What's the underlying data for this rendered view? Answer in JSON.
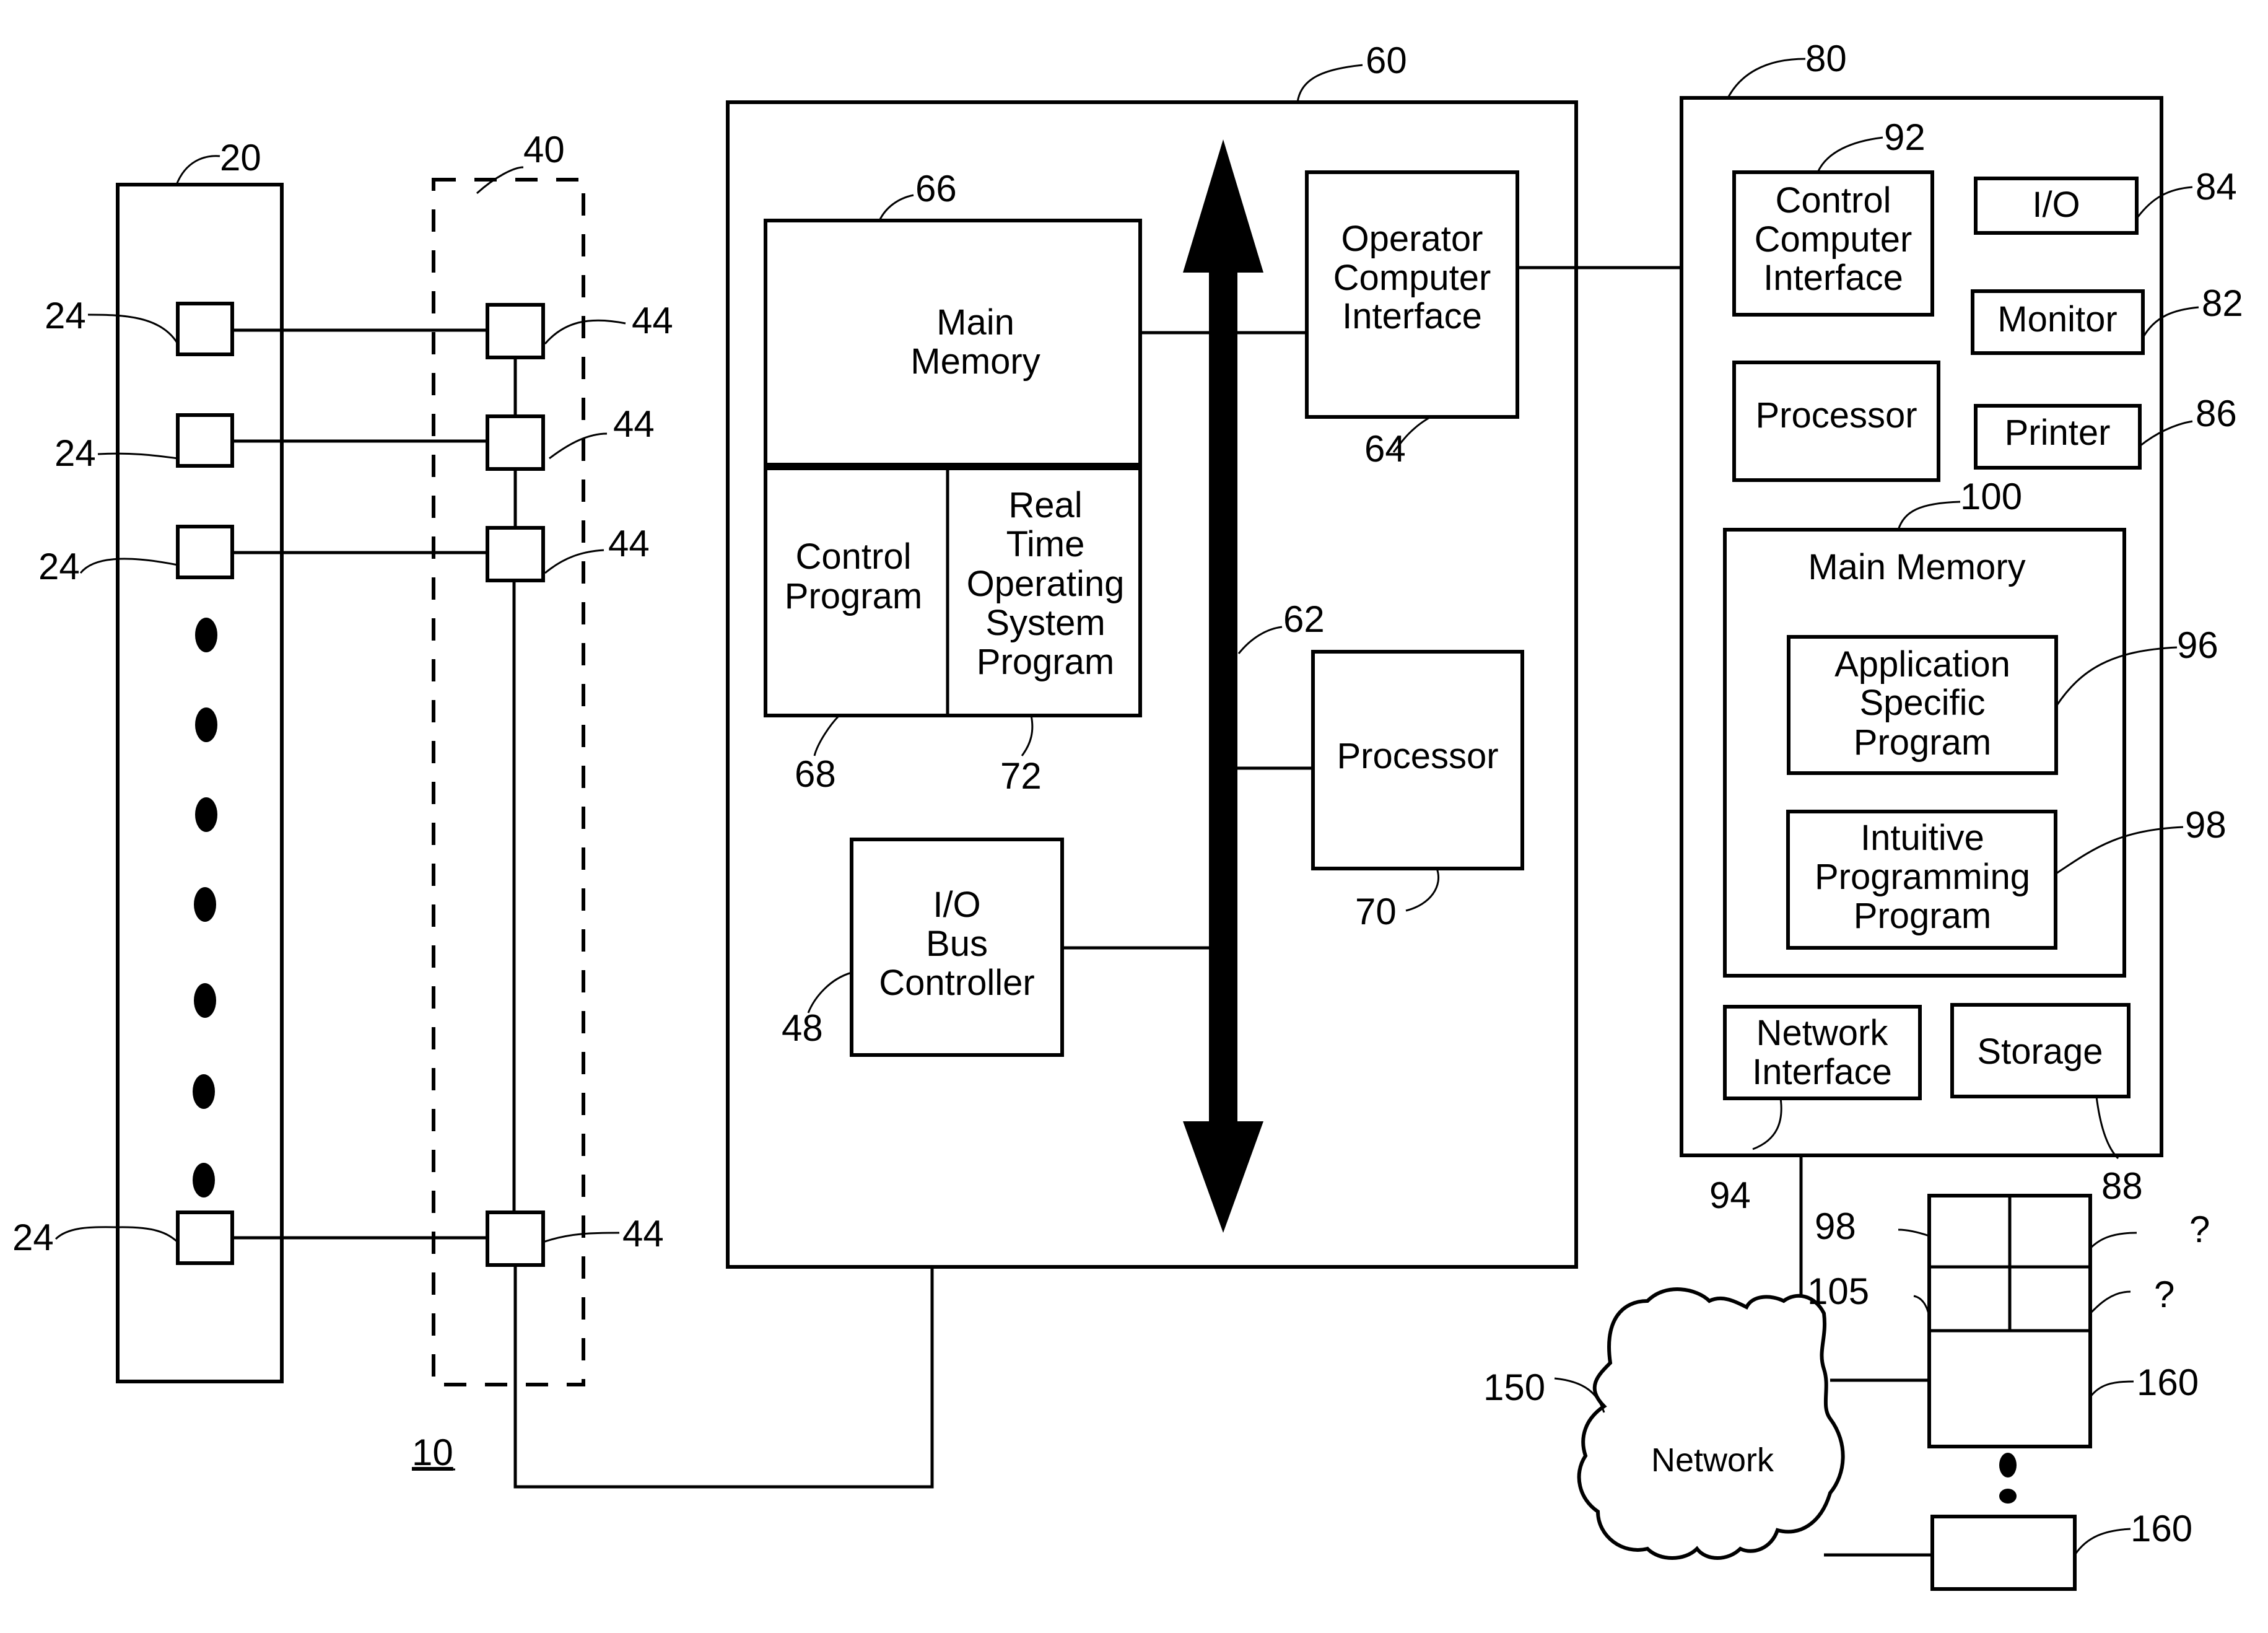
{
  "figure_label": "10",
  "ref": {
    "r20": "20",
    "r24": "24",
    "r40": "40",
    "r44": "44",
    "r60": "60",
    "r62": "62",
    "r64": "64",
    "r66": "66",
    "r68": "68",
    "r70": "70",
    "r72": "72",
    "r48": "48",
    "r80": "80",
    "r82": "82",
    "r84": "84",
    "r86": "86",
    "r88": "88",
    "r92": "92",
    "r94": "94",
    "r96": "96",
    "r98": "98",
    "r100": "100",
    "r105": "105",
    "r150": "150",
    "r160": "160",
    "q": "?"
  },
  "controller": {
    "main_memory": [
      "Main",
      "Memory"
    ],
    "control_program": [
      "Control",
      "Program"
    ],
    "rtos": [
      "Real",
      "Time",
      "Operating",
      "System",
      "Program"
    ],
    "operator_interface": [
      "Operator",
      "Computer",
      "Interface"
    ],
    "processor": "Processor",
    "io_bus_controller": [
      "I/O",
      "Bus",
      "Controller"
    ]
  },
  "operator_computer": {
    "control_interface": [
      "Control",
      "Computer",
      "Interface"
    ],
    "io": "I/O",
    "monitor": "Monitor",
    "processor": "Processor",
    "printer": "Printer",
    "main_memory": "Main Memory",
    "app_program": [
      "Application",
      "Specific",
      "Program"
    ],
    "intuitive_program": [
      "Intuitive",
      "Programming",
      "Program"
    ],
    "network_interface": [
      "Network",
      "Interface"
    ],
    "storage": "Storage"
  },
  "network": {
    "label": "Network"
  }
}
